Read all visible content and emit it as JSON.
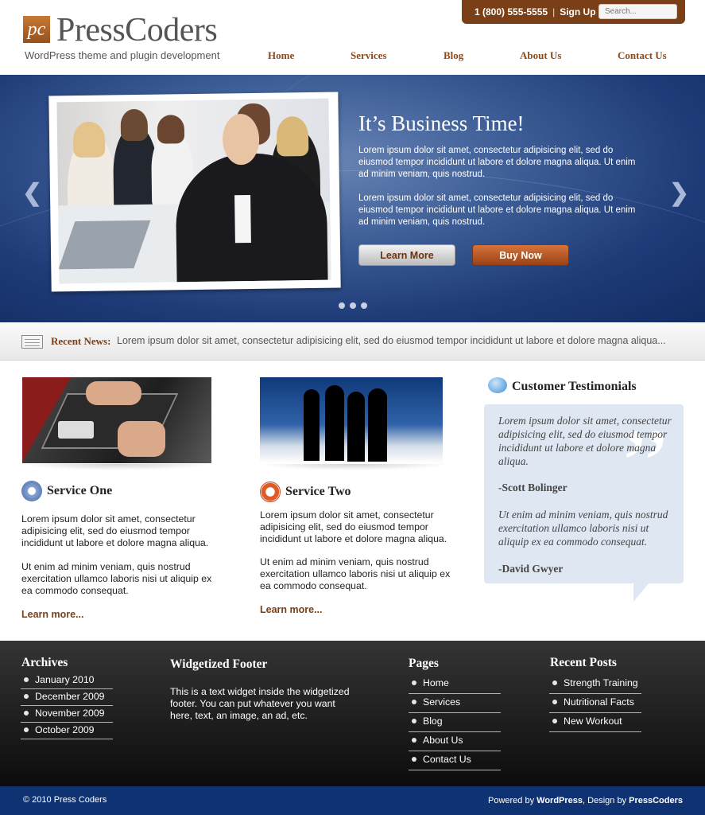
{
  "header": {
    "logo_mark": "pc",
    "logo_name": "PressCoders",
    "tagline": "WordPress theme and plugin development",
    "phone": "1 (800) 555-5555",
    "signup": "Sign Up",
    "search_placeholder": "Search...",
    "nav": [
      "Home",
      "Services",
      "Blog",
      "About Us",
      "Contact Us"
    ]
  },
  "hero": {
    "title": "It’s Business Time!",
    "paragraph_1": "Lorem ipsum dolor sit amet, consectetur adipisicing elit, sed do eiusmod tempor incididunt ut labore et dolore magna aliqua. Ut enim ad minim veniam, quis nostrud.",
    "paragraph_2": "Lorem ipsum dolor sit amet, consectetur adipisicing elit, sed do eiusmod tempor incididunt ut labore et dolore magna aliqua. Ut enim ad minim veniam, quis nostrud.",
    "learn_more": "Learn More",
    "buy_now": "Buy Now",
    "prev_arrow": "❮",
    "next_arrow": "❯"
  },
  "news": {
    "label": "Recent News:",
    "text": "Lorem ipsum dolor sit amet, consectetur adipisicing elit, sed do eiusmod tempor incididunt ut labore et dolore magna aliqua..."
  },
  "services": [
    {
      "title": "Service One",
      "p1": "Lorem ipsum dolor sit amet, consectetur adipisicing elit, sed do eiusmod tempor incididunt ut labore et dolore magna aliqua.",
      "p2": "Ut enim ad minim veniam, quis nostrud exercitation ullamco laboris nisi ut aliquip ex ea commodo consequat.",
      "more": "Learn more..."
    },
    {
      "title": "Service Two",
      "p1": "Lorem ipsum dolor sit amet, consectetur adipisicing elit, sed do eiusmod tempor incididunt ut labore et dolore magna aliqua.",
      "p2": "Ut enim ad minim veniam, quis nostrud exercitation ullamco laboris nisi ut aliquip ex ea commodo consequat.",
      "more": "Learn more..."
    }
  ],
  "testimonials": {
    "title": "Customer Testimonials",
    "quote_1": "Lorem ipsum dolor sit amet, consectetur adipisicing elit, sed do eiusmod tempor incididunt ut labore et dolore magna aliqua.",
    "author_1": "-Scott Bolinger",
    "quote_2": "Ut enim ad minim veniam, quis nostrud exercitation ullamco laboris nisi ut aliquip ex ea commodo consequat.",
    "author_2": "-David Gwyer",
    "quote_glyph": "”"
  },
  "footer": {
    "archives_title": "Archives",
    "archives": [
      "January 2010",
      "December 2009",
      "November 2009",
      "October 2009"
    ],
    "widget_title": "Widgetized Footer",
    "widget_text": "This is a text widget inside the widgetized footer.  You can put whatever you want here, text, an image, an ad, etc.",
    "pages_title": "Pages",
    "pages": [
      "Home",
      "Services",
      "Blog",
      "About Us",
      "Contact Us"
    ],
    "recent_title": "Recent Posts",
    "recent": [
      "Strength Training",
      "Nutritional Facts",
      "New Workout"
    ]
  },
  "bottom": {
    "copyright": "© 2010 Press Coders",
    "powered_prefix": "Powered by ",
    "powered_link": "WordPress",
    "design_prefix": ", Design by ",
    "design_link": "PressCoders"
  },
  "colors": {
    "brand_brown": "#7a3f17",
    "hero_blue": "#1e3b78",
    "footer_bar": "#0f3272"
  }
}
